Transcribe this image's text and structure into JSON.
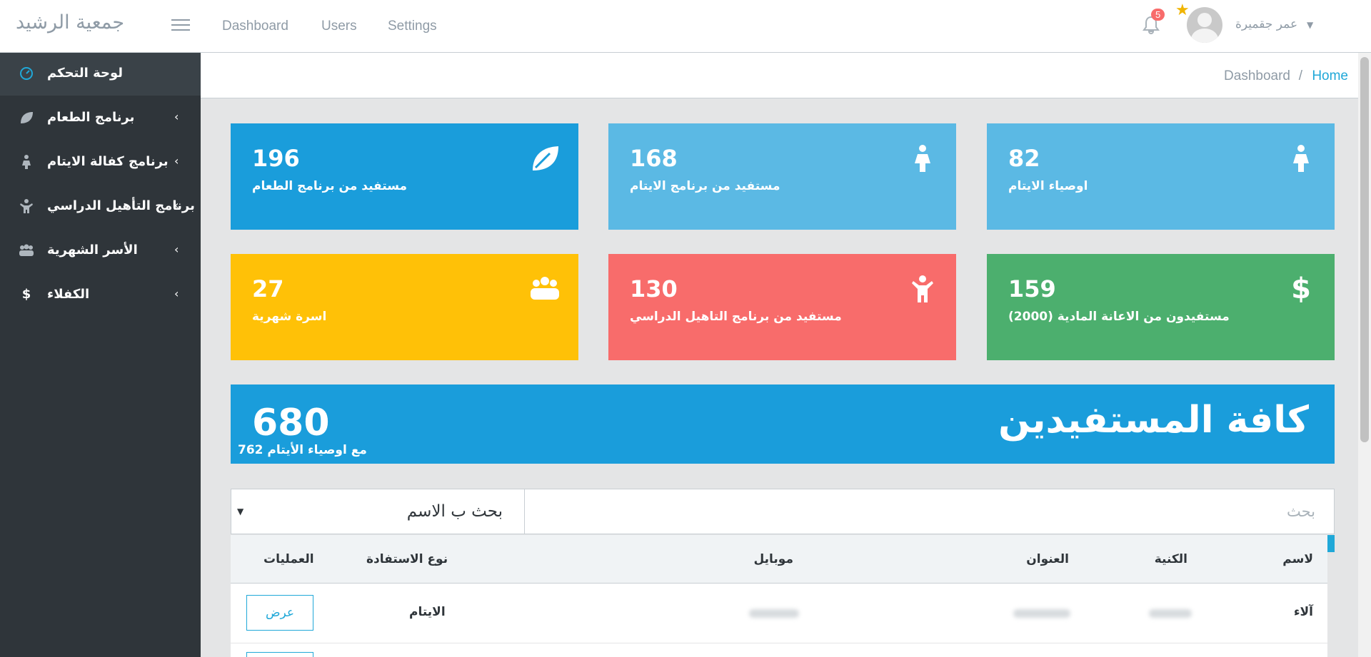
{
  "header": {
    "brand": "جمعية الرشيد",
    "nav": [
      "Dashboard",
      "Users",
      "Settings"
    ],
    "notification_count": "5",
    "user_name": "عمر جقميرة"
  },
  "sidebar": {
    "items": [
      {
        "label": "لوحة التحكم",
        "icon": "speedometer-icon"
      },
      {
        "label": "برنامج الطعام",
        "icon": "leaf-icon"
      },
      {
        "label": "برنامج كفالة الايتام",
        "icon": "child-icon"
      },
      {
        "label": "برنامج التأهيل الدراسي",
        "icon": "child-arms-icon"
      },
      {
        "label": "الأسر الشهرية",
        "icon": "people-icon"
      },
      {
        "label": "الكفلاء",
        "icon": "dollar-icon"
      }
    ]
  },
  "breadcrumb": {
    "parent": "Dashboard",
    "separator": "/",
    "current": "Home"
  },
  "cards": [
    {
      "value": "196",
      "label": "مستفيد من برنامج الطعام",
      "icon": "leaf-icon",
      "color": "#1a9ddb"
    },
    {
      "value": "168",
      "label": "مستفيد من برنامج الايتام",
      "icon": "child-icon",
      "color": "#5bb9e4"
    },
    {
      "value": "82",
      "label": "اوصياء الايتام",
      "icon": "child-icon",
      "color": "#5bb9e4"
    },
    {
      "value": "27",
      "label": "اسرة شهرية",
      "icon": "people-icon",
      "color": "#ffc107"
    },
    {
      "value": "130",
      "label": "مستفيد من برنامج التاهيل الدراسي",
      "icon": "child-arms-icon",
      "color": "#f86c6b"
    },
    {
      "value": "159",
      "label": "مستفيدون من الاعانة المادية (2000)",
      "icon": "dollar-icon",
      "color": "#4caf6e"
    }
  ],
  "banner": {
    "title": "كافة المستفيدين",
    "value": "680",
    "subtitle": "مع اوصياء الأيتام 762"
  },
  "search": {
    "select_value": "بحث ب الاسم",
    "placeholder": "بحث"
  },
  "table": {
    "headers": {
      "name": "لاسم",
      "kunya": "الكنية",
      "address": "العنوان",
      "mobile": "موبايل",
      "type": "نوع الاستفادة",
      "actions": "العمليات"
    },
    "rows": [
      {
        "name": "آلاء",
        "type": "الايتام",
        "action": "عرض"
      }
    ]
  }
}
